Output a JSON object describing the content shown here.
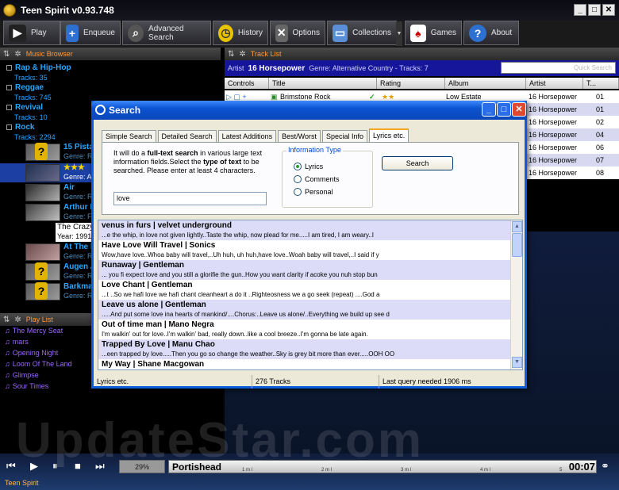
{
  "window": {
    "title": "Teen Spirit v0.93.748",
    "min": "_",
    "max": "□",
    "close": "✕"
  },
  "toolbar": [
    {
      "label": "Play",
      "icon": "play-icon"
    },
    {
      "label": "Enqueue",
      "icon": "plus-icon"
    },
    {
      "label": "Advanced Search",
      "icon": "magnifier-icon"
    },
    {
      "label": "History",
      "icon": "clock-icon"
    },
    {
      "label": "Options",
      "icon": "tools-icon"
    },
    {
      "label": "Collections",
      "icon": "folder-icon"
    },
    {
      "label": "Games",
      "icon": "cards-icon"
    },
    {
      "label": "About",
      "icon": "help-icon"
    }
  ],
  "browser": {
    "header": "Music Browser",
    "categories": [
      {
        "name": "Rap & Hip-Hop",
        "tracks": "Tracks: 35"
      },
      {
        "name": "Reggae",
        "tracks": "Tracks: 745"
      },
      {
        "name": "Revival",
        "tracks": "Tracks: 10"
      },
      {
        "name": "Rock",
        "tracks": "Tracks: 2294"
      }
    ],
    "albums": [
      {
        "name": "15 Pista",
        "genre": "Genre: R"
      },
      {
        "name": "",
        "genre": "Genre: A"
      },
      {
        "name": "Air",
        "genre": "Genre: R"
      },
      {
        "name": "Arthur B",
        "genre": "Genre: F"
      },
      {
        "name": "The Crazy",
        "genre": "Year: 1991"
      },
      {
        "name": "At The D",
        "genre": "Genre: R"
      },
      {
        "name": "Augen A",
        "genre": "Genre: R"
      },
      {
        "name": "Barkma",
        "genre": "Genre: R"
      }
    ]
  },
  "playlist": {
    "header": "Play List",
    "items": [
      "The Mercy Seat",
      "mars",
      "Opening Night",
      "Loom Of The Land",
      "Glimpse",
      "Sour Times"
    ]
  },
  "tracklist": {
    "header": "Track List",
    "artist_prefix": "Artist",
    "artist": "16 Horsepower",
    "genre_info": "Genre: Alternative Country - Tracks: 7",
    "quick_search_placeholder": "Quick Search",
    "columns": [
      "Controls",
      "Title",
      "Rating",
      "Album",
      "Artist",
      "T..."
    ],
    "rows": [
      {
        "title": "Brimstone Rock",
        "album": "Low Estate",
        "artist": "16 Horsepower",
        "track": "01"
      },
      {
        "title": "",
        "album": "",
        "artist": "16 Horsepower",
        "track": "01"
      },
      {
        "title": "",
        "album": "",
        "artist": "16 Horsepower",
        "track": "02"
      },
      {
        "title": "",
        "album": "",
        "artist": "16 Horsepower",
        "track": "04"
      },
      {
        "title": "",
        "album": "",
        "artist": "16 Horsepower",
        "track": "06"
      },
      {
        "title": "",
        "album": "",
        "artist": "16 Horsepower",
        "track": "07"
      },
      {
        "title": "",
        "album": "",
        "artist": "16 Horsepower",
        "track": "08"
      }
    ]
  },
  "dialog": {
    "title": "Search",
    "tabs": [
      "Simple Search",
      "Detailed Search",
      "Latest Additions",
      "Best/Worst",
      "Special Info",
      "Lyrics etc."
    ],
    "active_tab": 5,
    "help_1": "It will do a ",
    "help_b1": "full-text search",
    "help_2": " in various large text information fields.Select the ",
    "help_b2": "type of text",
    "help_3": " to be searched. Please enter at least 4 characters.",
    "query": "love",
    "info_type_label": "Information Type",
    "options": [
      "Lyrics",
      "Comments",
      "Personal"
    ],
    "selected_option": 0,
    "search_button": "Search",
    "results": [
      {
        "title": "venus in furs | velvet underground",
        "text": "...e the whip, in love not given lightly..Taste the whip, now plead for me.....I am tired, I am weary..I"
      },
      {
        "title": "Have Love Will Travel | Sonics",
        "text": "Wow,have love..Whoa baby will travel,..Uh huh, uh huh,have love..Woah baby will travel,..I said if y"
      },
      {
        "title": "Runaway | Gentleman",
        "text": "... you fi expect love and you still a glorifie the gun..How you want clarity if acoke you nuh stop bun"
      },
      {
        "title": "Love Chant | Gentleman",
        "text": "...t ..So we hafi love we hafi chant cleanheart a do it ..Righteosness we a go seek (repeat) ....God a"
      },
      {
        "title": "Leave us alone | Gentleman",
        "text": ".....And put some love ina hearts of mankind/....Chorus:..Leave us alone/..Everything we build up see d"
      },
      {
        "title": "Out of time man | Mano Negra",
        "text": "I'm walkin' out for love..I'm walkin' bad, really down..like a cool breeze..I'm gonna be late again."
      },
      {
        "title": "Trapped By Love | Manu Chao",
        "text": "...een trapped by love.....Then you go so change the weather..Sky is grey bit more than ever.....OOH OO"
      },
      {
        "title": "My Way | Shane Macgowan",
        "text": ""
      }
    ],
    "status": {
      "mode": "Lyrics etc.",
      "tracks": "276 Tracks",
      "last_query": "Last query needed 1906 ms"
    }
  },
  "player": {
    "volume": "29%",
    "now_playing": "Portishead",
    "time": "00:07",
    "scale": [
      "1 m l",
      "2 m l",
      "3 m l",
      "4 m l",
      "5"
    ],
    "status": "Teen Spirit",
    "watermark": "UpdateStar.com"
  }
}
